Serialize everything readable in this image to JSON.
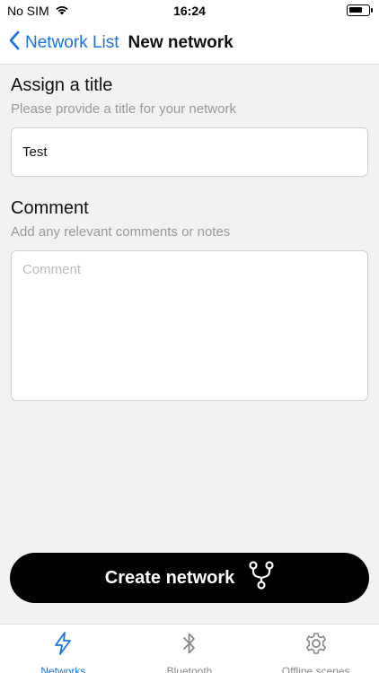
{
  "status_bar": {
    "carrier": "No SIM",
    "time": "16:24",
    "battery_level": 0.75
  },
  "nav": {
    "back_label": "Network List",
    "title": "New network"
  },
  "form": {
    "title_section": {
      "heading": "Assign a title",
      "hint": "Please provide a title for your network",
      "value": "Test"
    },
    "comment_section": {
      "heading": "Comment",
      "hint": "Add any relevant comments or notes",
      "placeholder": "Comment",
      "value": ""
    }
  },
  "create_button": {
    "label": "Create network",
    "icon": "fork-icon"
  },
  "tabs": [
    {
      "label": "Networks",
      "icon": "lightning-icon",
      "active": true
    },
    {
      "label": "Bluetooth",
      "icon": "bluetooth-icon",
      "active": false
    },
    {
      "label": "Offline scenes",
      "icon": "gear-icon",
      "active": false
    }
  ],
  "colors": {
    "accent": "#1a73e8",
    "button_bg": "#000000",
    "background": "#f2f2f2"
  }
}
